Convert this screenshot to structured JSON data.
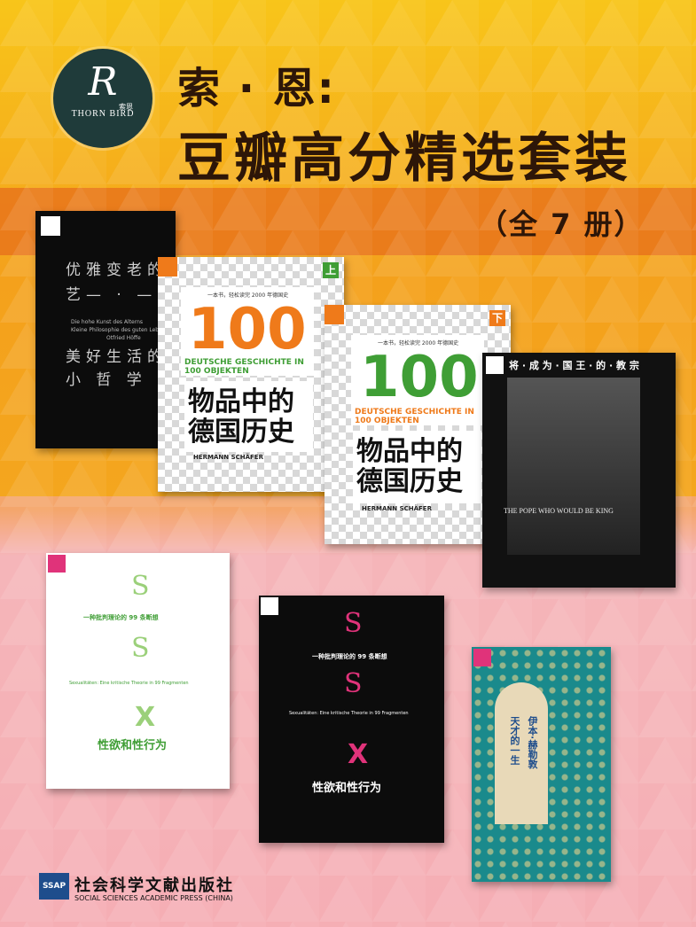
{
  "header": {
    "logo_monogram": "R",
    "logo_brand": "THORN BIRD",
    "logo_cn": "索恩",
    "title_line1": "索 · 恩:",
    "title_line2": "豆瓣高分精选套装",
    "subtitle": "（全 7 册）"
  },
  "books": {
    "aging": {
      "line1": "优雅变老的",
      "line2": "艺— · —术",
      "line3": "美好生活的",
      "line4": "小  哲  学",
      "de1": "Die hohe Kunst des Alterns",
      "de2": "Kleine Philosophie des guten Lebens",
      "de3": "Otfried Höffe"
    },
    "hundred_up": {
      "slogan": "一本书，轻松读完 2000 年德国史",
      "number": "100",
      "de1": "DEUTSCHE GESCHICHTE IN",
      "de2": "100 OBJEKTEN",
      "title1": "物品中的",
      "title2": "德国历史",
      "author": "HERMANN SCHÄFER",
      "vol": "上"
    },
    "hundred_down": {
      "slogan": "一本书，轻松读完 2000 年德国史",
      "number": "100",
      "de1": "DEUTSCHE GESCHICHTE IN",
      "de2": "100 OBJEKTEN",
      "title1": "物品中的",
      "title2": "德国历史",
      "author": "HERMANN SCHÄFER",
      "vol": "下"
    },
    "pope": {
      "title": "将 · 成 为 · 国 王 · 的 · 教 宗",
      "en": "THE POPE WHO WOULD BE KING"
    },
    "sex_white": {
      "sub": "一种批判理论的 99 条断想",
      "de": "Sexualitäten: Eine kritische Theorie in 99 Fragmenten",
      "title": "性欲和性行为"
    },
    "sex_black": {
      "sub": "一种批判理论的 99 条断想",
      "de": "Sexualitäten: Eine kritische Theorie in 99 Fragmenten",
      "title": "性欲和性行为"
    },
    "khaldun": {
      "title1": "伊本·赫勒敦",
      "title2": "天才的一生"
    }
  },
  "publisher": {
    "mark": "SSAP",
    "name_cn": "社会科学文献出版社",
    "name_en": "SOCIAL SCIENCES ACADEMIC PRESS (CHINA)"
  },
  "colors": {
    "orange": "#f08a1c",
    "yellow": "#f5c318",
    "pink": "#f6c4c6",
    "green_accent": "#3f9e35",
    "magenta_accent": "#e0337a"
  }
}
